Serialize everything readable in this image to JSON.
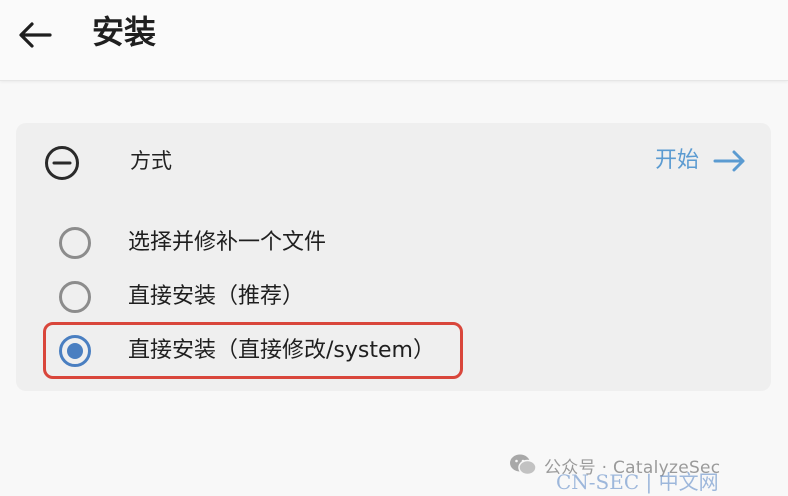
{
  "header": {
    "back_icon": "arrow-left-icon",
    "title": "安装"
  },
  "section": {
    "collapse_icon": "minus-circle-icon",
    "label": "方式",
    "start_label": "开始",
    "start_icon": "arrow-right-icon",
    "accent_color": "#5b9bd1"
  },
  "options": [
    {
      "label": "选择并修补一个文件",
      "checked": false
    },
    {
      "label": "直接安装（推荐）",
      "checked": false
    },
    {
      "label": "直接安装（直接修改/system）",
      "checked": true
    }
  ],
  "highlight_color": "#d9463b",
  "watermark": {
    "text": "公众号 · CatalyzeSec",
    "site": "CN-SEC | 中文网"
  }
}
